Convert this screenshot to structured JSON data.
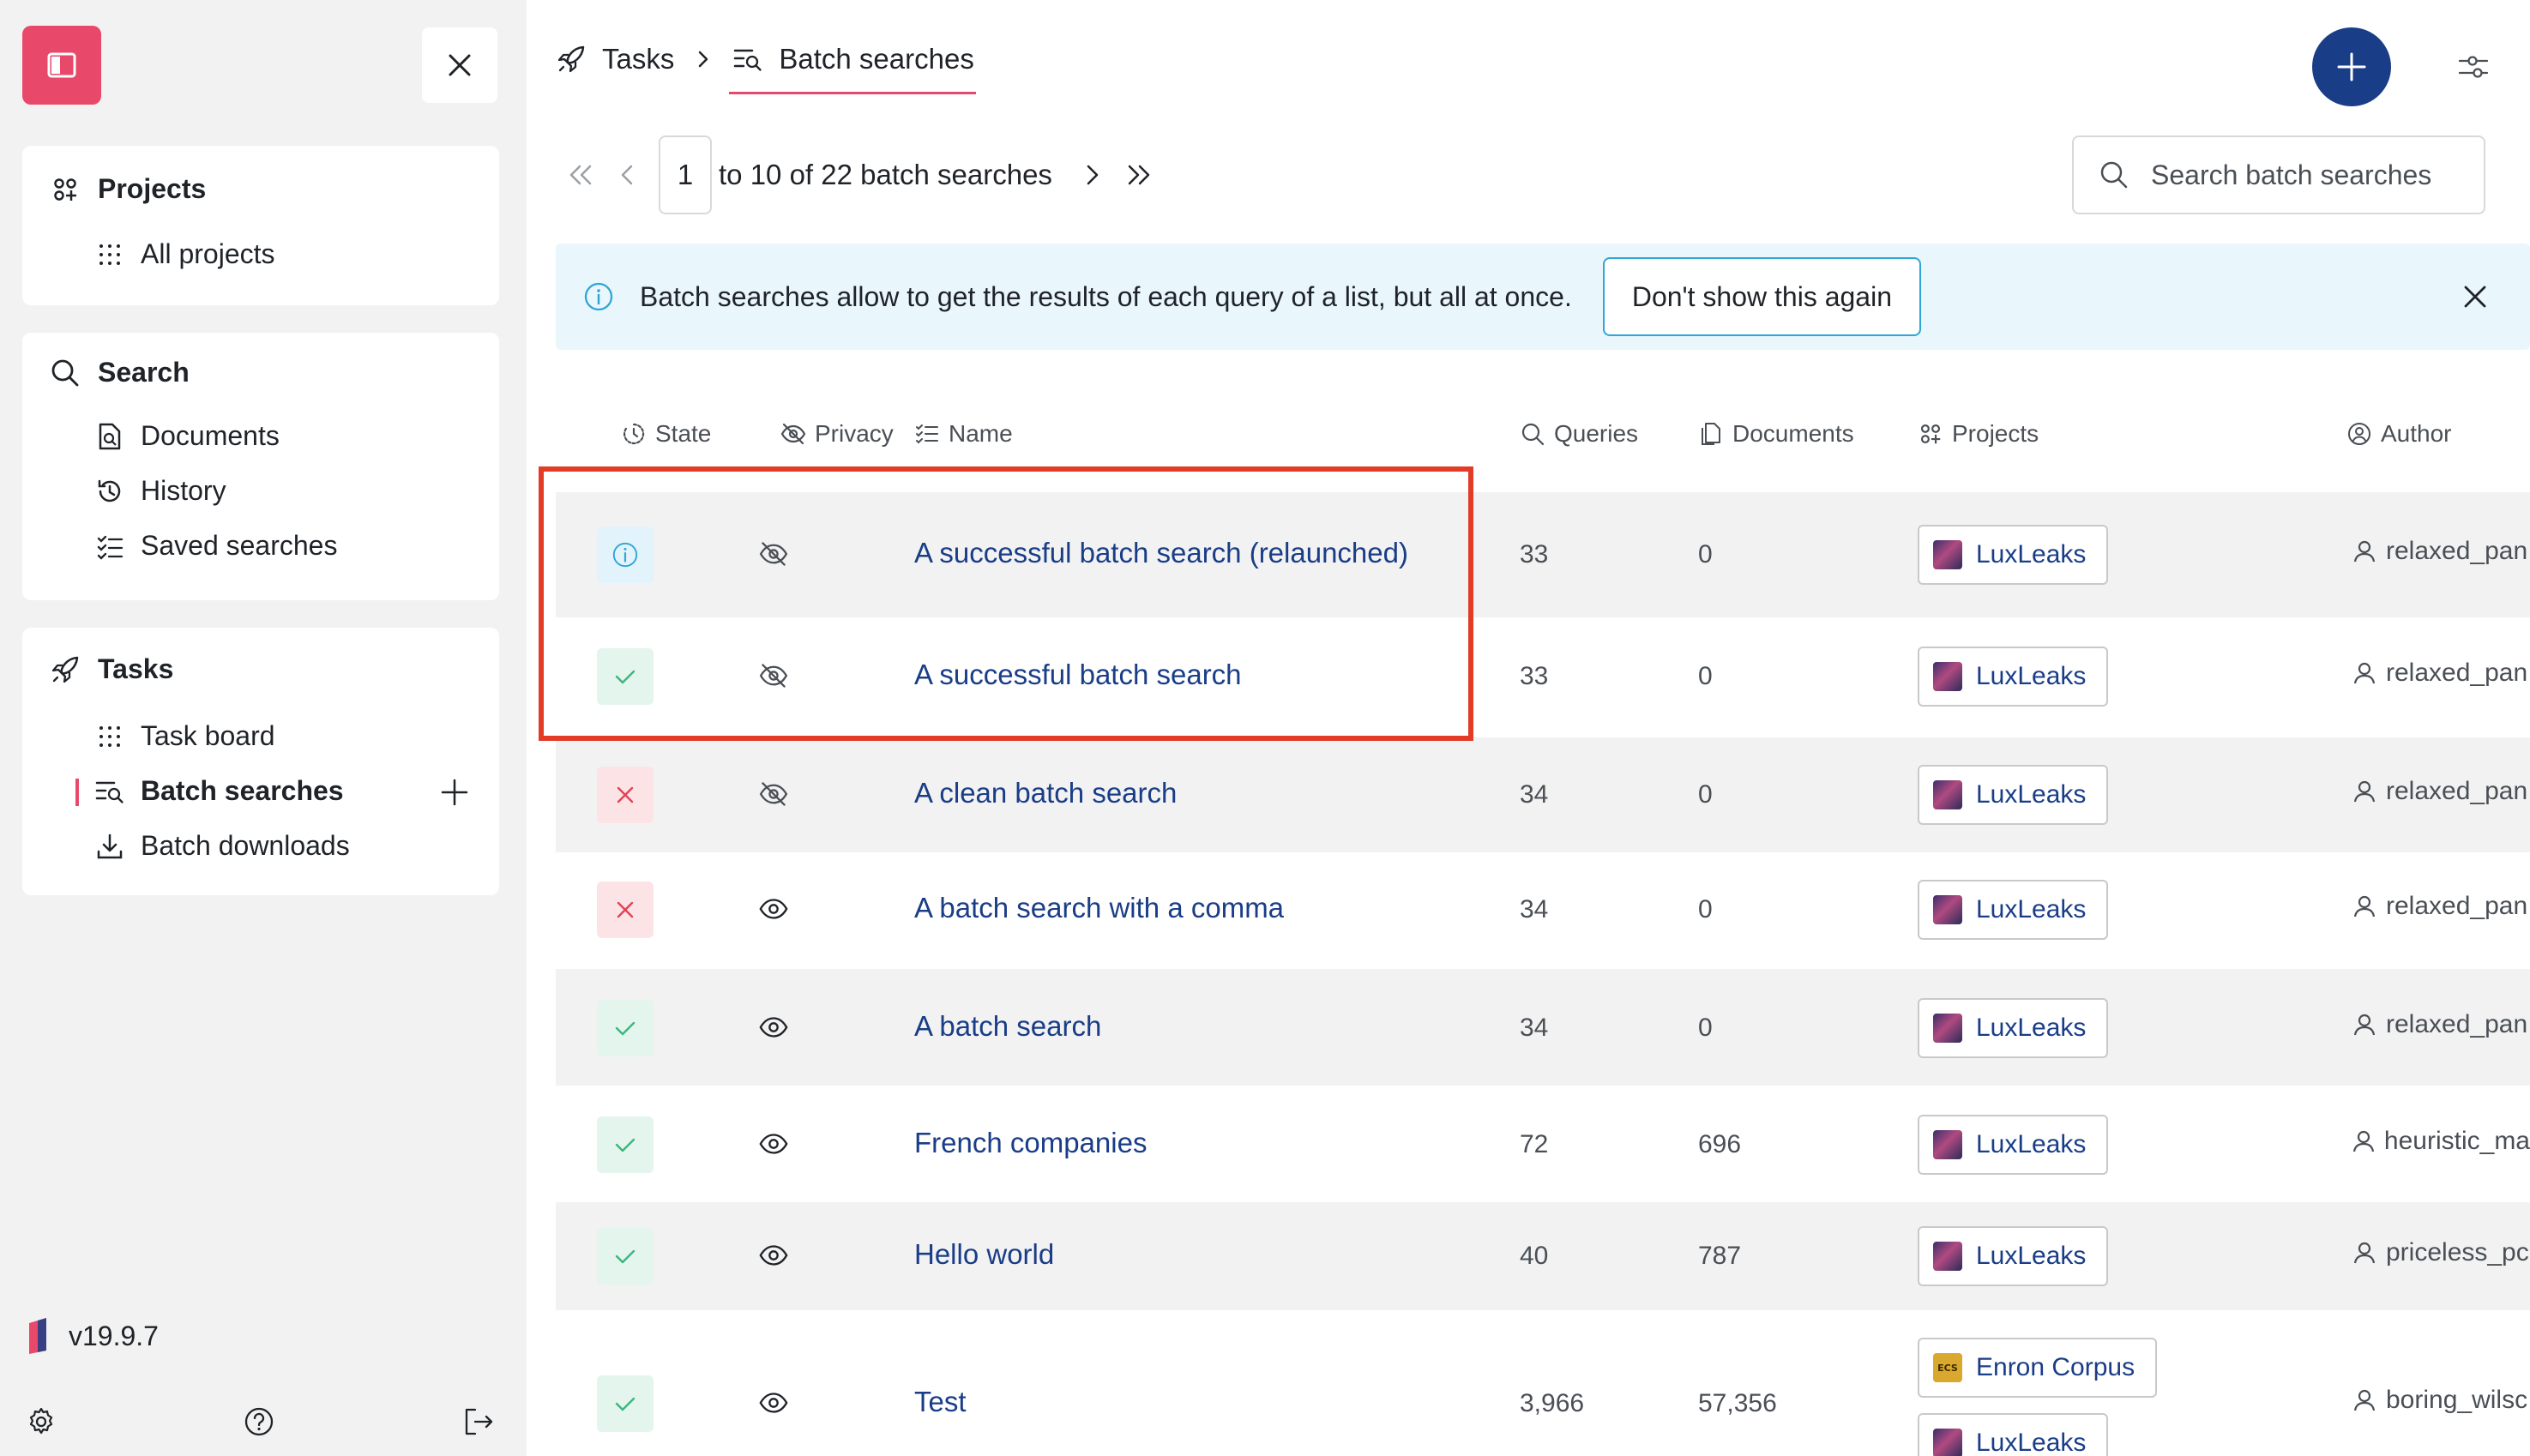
{
  "sidebar": {
    "projects": {
      "title": "Projects",
      "items": [
        "All projects"
      ]
    },
    "search": {
      "title": "Search",
      "items": [
        "Documents",
        "History",
        "Saved searches"
      ]
    },
    "tasks": {
      "title": "Tasks",
      "items": [
        "Task board",
        "Batch searches",
        "Batch downloads"
      ],
      "active": "Batch searches"
    },
    "version": "v19.9.7"
  },
  "header": {
    "breadcrumb": [
      "Tasks",
      "Batch searches"
    ]
  },
  "pagination": {
    "current_page": "1",
    "summary": "to 10 of 22 batch searches"
  },
  "search": {
    "placeholder": "Search batch searches"
  },
  "banner": {
    "text": "Batch searches allow to get the results of each query of a list, but all at once.",
    "button": "Don't show this again"
  },
  "table": {
    "columns": [
      "State",
      "Privacy",
      "Name",
      "Queries",
      "Documents",
      "Projects",
      "Author"
    ],
    "rows": [
      {
        "state": "info",
        "privacy": "private",
        "name": "A successful batch search (relaunched)",
        "queries": "33",
        "documents": "0",
        "projects": [
          "LuxLeaks"
        ],
        "author": "relaxed_pan"
      },
      {
        "state": "success",
        "privacy": "private",
        "name": "A successful batch search",
        "queries": "33",
        "documents": "0",
        "projects": [
          "LuxLeaks"
        ],
        "author": "relaxed_pan"
      },
      {
        "state": "failure",
        "privacy": "private",
        "name": "A clean batch search",
        "queries": "34",
        "documents": "0",
        "projects": [
          "LuxLeaks"
        ],
        "author": "relaxed_pan"
      },
      {
        "state": "failure",
        "privacy": "public",
        "name": "A batch search with a comma",
        "queries": "34",
        "documents": "0",
        "projects": [
          "LuxLeaks"
        ],
        "author": "relaxed_pan"
      },
      {
        "state": "success",
        "privacy": "public",
        "name": "A batch search",
        "queries": "34",
        "documents": "0",
        "projects": [
          "LuxLeaks"
        ],
        "author": "relaxed_pan"
      },
      {
        "state": "success",
        "privacy": "public",
        "name": "French companies",
        "queries": "72",
        "documents": "696",
        "projects": [
          "LuxLeaks"
        ],
        "author": "heuristic_ma"
      },
      {
        "state": "success",
        "privacy": "public",
        "name": "Hello world",
        "queries": "40",
        "documents": "787",
        "projects": [
          "LuxLeaks"
        ],
        "author": "priceless_pc"
      },
      {
        "state": "success",
        "privacy": "public",
        "name": "Test",
        "queries": "3,966",
        "documents": "57,356",
        "projects": [
          "Enron Corpus",
          "LuxLeaks"
        ],
        "author": "boring_wilsc"
      }
    ]
  },
  "project_thumbs": {
    "Enron Corpus": "ECS"
  },
  "colors": {
    "accent": "#e8496a",
    "primary": "#193d87",
    "highlight": "#e23b26",
    "banner_bg": "#e9f6fc",
    "success": "#3bb77e",
    "failure": "#e04356",
    "info": "#2ea6d6"
  }
}
